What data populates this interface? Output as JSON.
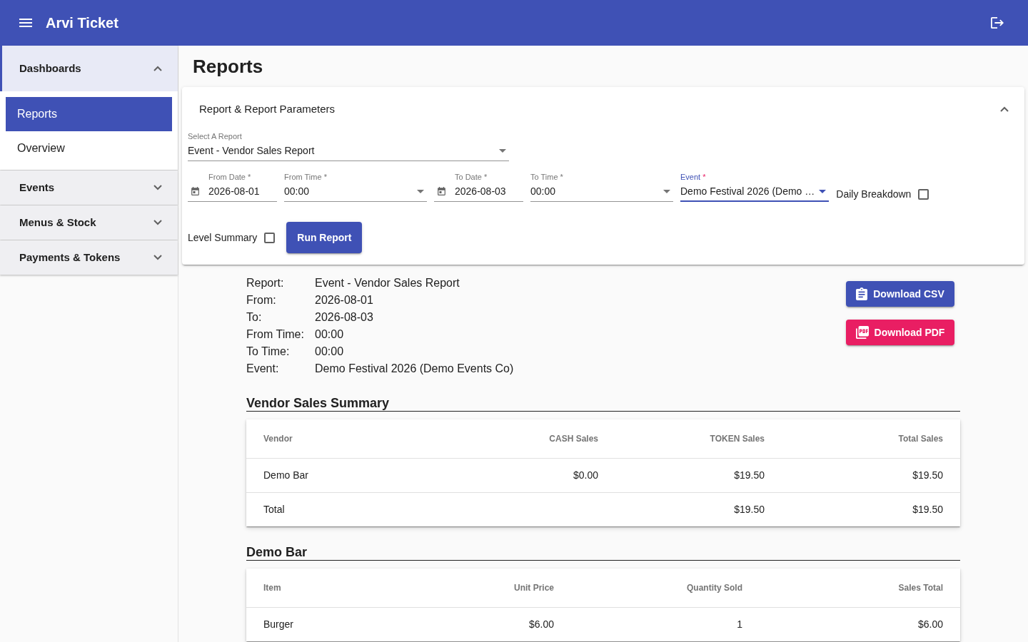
{
  "app_bar": {
    "title": "Arvi Ticket"
  },
  "sidebar": {
    "groups": [
      {
        "label": "Dashboards",
        "expanded": true,
        "children": [
          {
            "label": "Reports",
            "selected": true
          },
          {
            "label": "Overview",
            "selected": false
          }
        ]
      },
      {
        "label": "Events",
        "expanded": false
      },
      {
        "label": "Menus & Stock",
        "expanded": false
      },
      {
        "label": "Payments & Tokens",
        "expanded": false
      }
    ]
  },
  "page": {
    "title": "Reports"
  },
  "parameters_panel": {
    "title": "Report & Report Parameters",
    "expanded": true,
    "rows": [
      [
        {
          "kind": "select",
          "label": "Select A Report",
          "value": "Event - Vendor Sales Report",
          "focused": false
        }
      ],
      [
        {
          "kind": "date",
          "label": "From Date",
          "required_mark": "*",
          "value": "2026-08-01",
          "focused": false
        },
        {
          "kind": "time",
          "label": "From Time",
          "required_mark": "*",
          "value": "00:00",
          "focused": false
        },
        {
          "kind": "date",
          "label": "To Date",
          "required_mark": "*",
          "value": "2026-08-03",
          "focused": false
        },
        {
          "kind": "time",
          "label": "To Time",
          "required_mark": "*",
          "value": "00:00",
          "focused": false
        },
        {
          "kind": "select",
          "label": "Event",
          "required_mark": "*",
          "value": "Demo Festival 2026 (Demo …",
          "focused": true
        },
        {
          "kind": "checkbox",
          "label": "Daily Breakdown",
          "checked": false
        }
      ],
      [
        {
          "kind": "checkbox",
          "label": "Level Summary",
          "checked": false
        },
        {
          "kind": "button",
          "label": "Run Report"
        }
      ]
    ]
  },
  "report_summary": [
    {
      "label": "Report:",
      "value": "Event - Vendor Sales Report"
    },
    {
      "label": "From:",
      "value": "2026-08-01"
    },
    {
      "label": "To:",
      "value": "2026-08-03"
    },
    {
      "label": "From Time:",
      "value": "00:00"
    },
    {
      "label": "To Time:",
      "value": "00:00"
    },
    {
      "label": "Event:",
      "value": "Demo Festival 2026 (Demo Events Co)"
    }
  ],
  "downloads": [
    {
      "kind": "csv",
      "label": "Download CSV"
    },
    {
      "kind": "pdf",
      "label": "Download PDF"
    }
  ],
  "sections": [
    {
      "title": "Vendor Sales Summary",
      "table": {
        "columns": [
          "Vendor",
          "CASH Sales",
          "TOKEN Sales",
          "Total Sales"
        ],
        "rows": [
          [
            "Demo Bar",
            "$0.00",
            "$19.50",
            "$19.50"
          ],
          [
            "Total",
            null,
            "$19.50",
            "$19.50"
          ]
        ]
      }
    },
    {
      "title": "Demo Bar",
      "table": {
        "columns": [
          "Item",
          "Unit Price",
          "Quantity Sold",
          "Sales Total"
        ],
        "rows": [
          [
            "Burger",
            "$6.00",
            "1",
            "$6.00"
          ]
        ]
      }
    }
  ]
}
